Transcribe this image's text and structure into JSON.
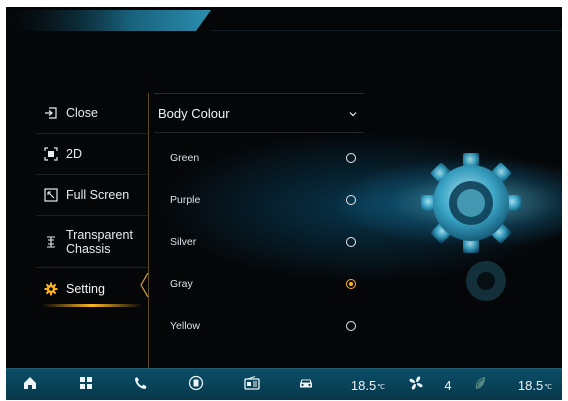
{
  "sidebar": {
    "items": [
      {
        "label": "Close",
        "icon": "exit-icon"
      },
      {
        "label": "2D",
        "icon": "view-2d-icon"
      },
      {
        "label": "Full Screen",
        "icon": "fullscreen-icon"
      },
      {
        "label_line1": "Transparent",
        "label_line2": "Chassis",
        "icon": "chassis-icon"
      },
      {
        "label": "Setting",
        "icon": "gear-icon"
      }
    ],
    "active_index": 4
  },
  "panel": {
    "dropdown_label": "Body Colour",
    "options": [
      {
        "label": "Green",
        "selected": false
      },
      {
        "label": "Purple",
        "selected": false
      },
      {
        "label": "Silver",
        "selected": false
      },
      {
        "label": "Gray",
        "selected": true
      },
      {
        "label": "Yellow",
        "selected": false
      }
    ]
  },
  "bottombar": {
    "temp_left": "18.5",
    "temp_right": "18.5",
    "temp_unit": "℃",
    "fan_speed": "4",
    "icons": [
      "home-icon",
      "apps-grid-icon",
      "phone-icon",
      "media-icon",
      "radio-icon",
      "car-icon",
      "fan-icon",
      "seat-heat-icon"
    ]
  },
  "colors": {
    "accent": "#ffb21a",
    "bottombar": "#0a4e67",
    "glow": "#4fd4f5",
    "background": "#050608"
  }
}
